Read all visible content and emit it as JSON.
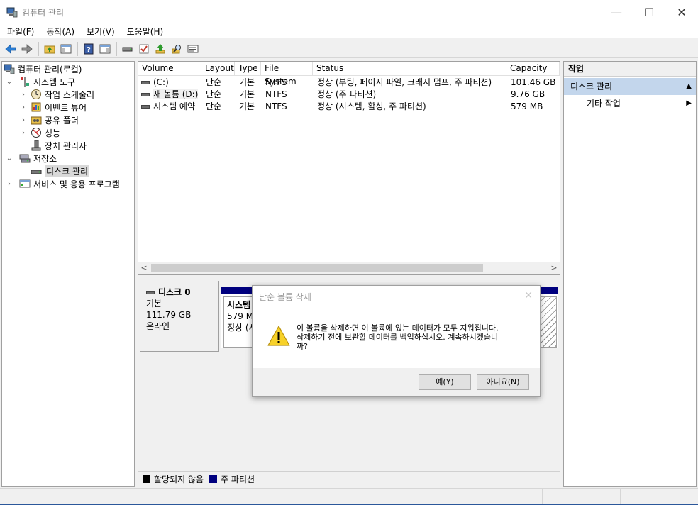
{
  "window": {
    "title": "컴퓨터 관리",
    "controls": {
      "minimize": "—",
      "maximize": "☐",
      "close": "✕"
    }
  },
  "menu": [
    "파일(F)",
    "동작(A)",
    "보기(V)",
    "도움말(H)"
  ],
  "toolbar": [
    "back-icon",
    "forward-icon",
    "up-folder-icon",
    "show-hide-tree-icon",
    "help-icon",
    "show-hide-action-icon",
    "disk-drive-icon",
    "check-icon",
    "upload-icon",
    "search-icon",
    "properties-icon"
  ],
  "tree": {
    "root": "컴퓨터 관리(로컬)",
    "system_tools": "시스템 도구",
    "task_scheduler": "작업 스케줄러",
    "event_viewer": "이벤트 뷰어",
    "shared_folders": "공유 폴더",
    "performance": "성능",
    "device_manager": "장치 관리자",
    "storage": "저장소",
    "disk_management": "디스크 관리",
    "services": "서비스 및 응용 프로그램"
  },
  "volumes": {
    "headers": [
      "Volume",
      "Layout",
      "Type",
      "File System",
      "Status",
      "Capacity"
    ],
    "rows": [
      [
        "(C:)",
        "단순",
        "기본",
        "NTFS",
        "정상 (부팅, 페이지 파일, 크래시 덤프, 주 파티션)",
        "101.46 GB"
      ],
      [
        "새 볼륨 (D:)",
        "단순",
        "기본",
        "NTFS",
        "정상 (주 파티션)",
        "9.76 GB"
      ],
      [
        "시스템 예약",
        "단순",
        "기본",
        "NTFS",
        "정상 (시스템, 활성, 주 파티션)",
        "579 MB"
      ]
    ],
    "scroll_left": "<",
    "scroll_right": ">"
  },
  "disk": {
    "name": "디스크 0",
    "type": "기본",
    "size": "111.79 GB",
    "state": "온라인",
    "partition_name": "시스템",
    "partition_size": "579 MI",
    "partition_status": "정상 (시"
  },
  "legend": {
    "unallocated": "할당되지 않음",
    "primary": "주 파티션"
  },
  "actions": {
    "header": "작업",
    "group": "디스크 관리",
    "more": "기타 작업"
  },
  "dialog": {
    "title": "단순 볼륨 삭제",
    "close": "✕",
    "message_line1": "이 볼륨을 삭제하면 이 볼륨에 있는 데이터가 모두 지워집니다.",
    "message_line2": "삭제하기 전에 보관할 데이터를 백업하십시오. 계속하시겠습니",
    "message_line3": "까?",
    "yes": "예(Y)",
    "no": "아니요(N)"
  },
  "colors": {
    "primary_partition": "#00007f",
    "unallocated": "#000000",
    "selection": "#c3d6ec",
    "accent": "#0078d7"
  }
}
